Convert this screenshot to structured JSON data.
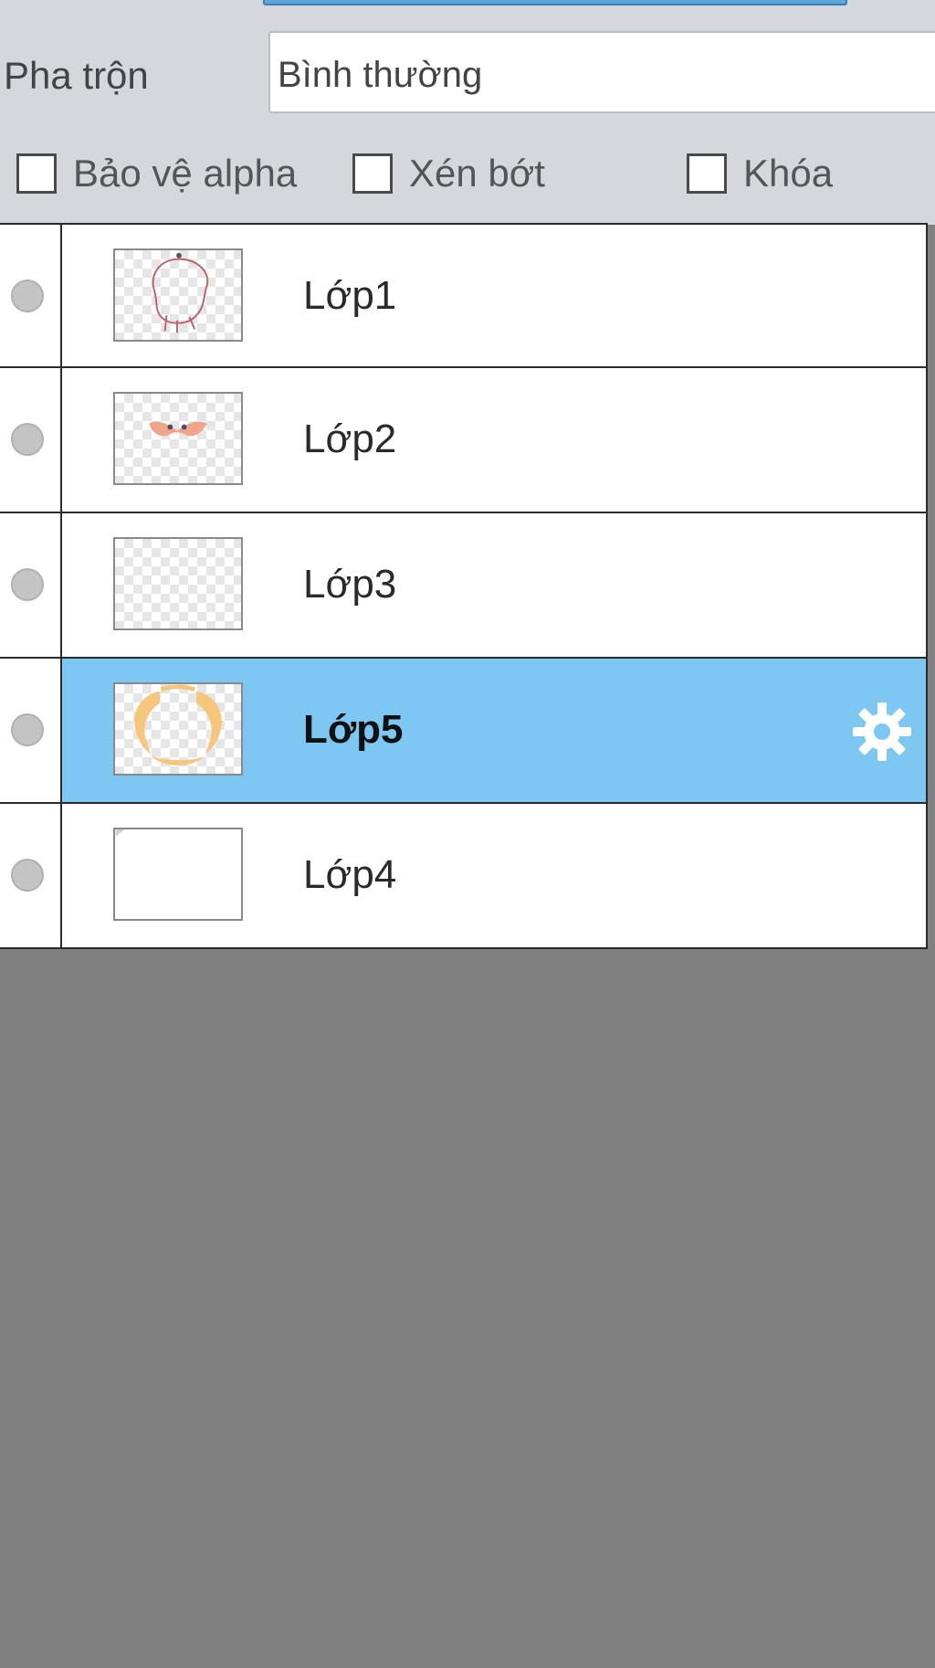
{
  "blend": {
    "label": "Pha trộn",
    "value": "Bình thường"
  },
  "options": {
    "protect_alpha": {
      "label": "Bảo vệ alpha",
      "checked": false
    },
    "clip": {
      "label": "Xén bớt",
      "checked": false
    },
    "lock": {
      "label": "Khóa",
      "checked": false
    }
  },
  "layers": [
    {
      "name": "Lớp1",
      "selected": false,
      "thumb": "red-outline-sketch"
    },
    {
      "name": "Lớp2",
      "selected": false,
      "thumb": "salmon-bow-eyes"
    },
    {
      "name": "Lớp3",
      "selected": false,
      "thumb": "empty-transparent"
    },
    {
      "name": "Lớp5",
      "selected": true,
      "thumb": "orange-ring-shapes",
      "icon": "gear-icon"
    },
    {
      "name": "Lớp4",
      "selected": false,
      "thumb": "white-fill"
    }
  ],
  "colors": {
    "panel_bg": "#d4d8dd",
    "selected_row": "#7dc7f3",
    "empty_area": "#808080",
    "slider_accent": "#5fa6d8"
  }
}
